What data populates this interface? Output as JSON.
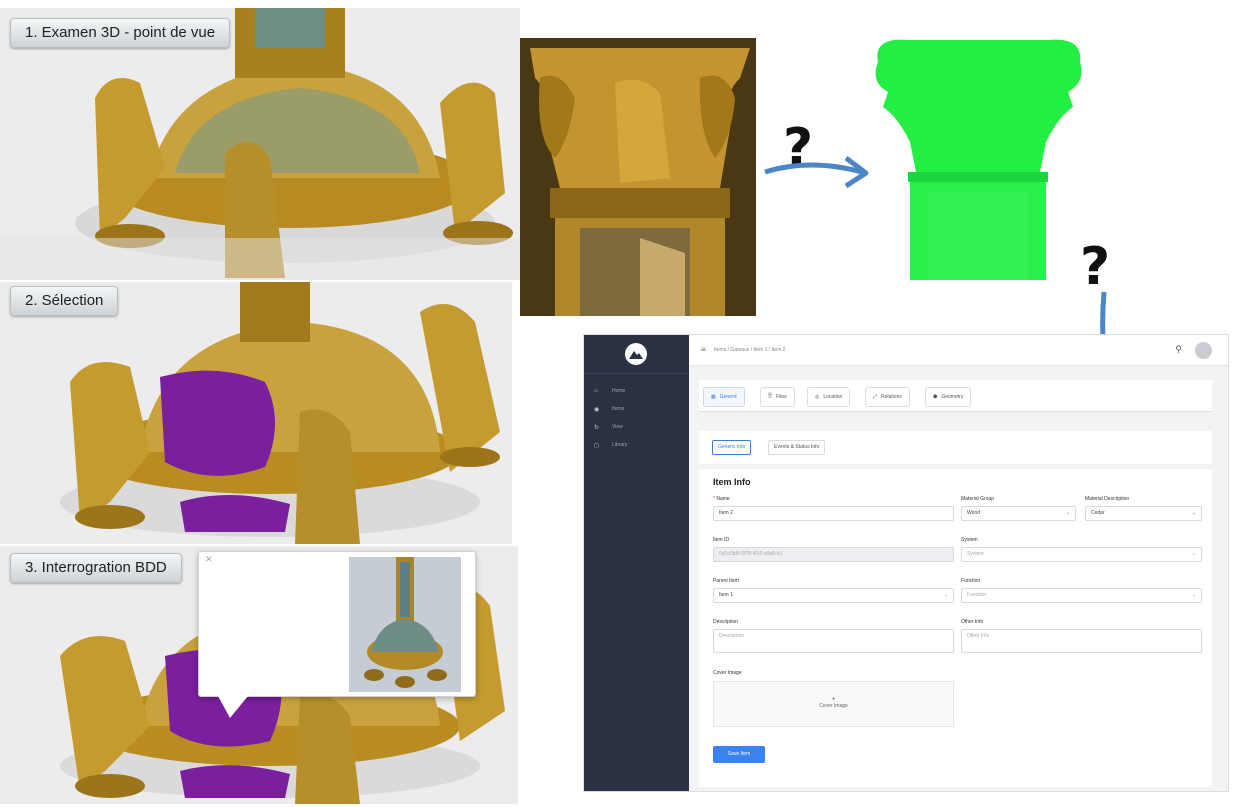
{
  "steps": [
    {
      "label": "1. Examen 3D - point de vue"
    },
    {
      "label": "2. Sélection"
    },
    {
      "label": "3. Interrogration BDD"
    }
  ],
  "annotations": {
    "question_mark_1": "?",
    "question_mark_2": "?"
  },
  "popup": {
    "close": "✕"
  },
  "colors": {
    "selection": "#7a1f9e",
    "point_cloud": "#22ee44",
    "arrow": "#4d86c6",
    "gold": "#b8902c",
    "button": "#3b82f6"
  },
  "app": {
    "sidebar": {
      "items": [
        {
          "icon": "home-icon",
          "glyph": "⌂",
          "label": "Home"
        },
        {
          "icon": "items-icon",
          "glyph": "◉",
          "label": "Items"
        },
        {
          "icon": "history-icon",
          "glyph": "↻",
          "label": "View"
        },
        {
          "icon": "library-icon",
          "glyph": "◻",
          "label": "Library"
        }
      ]
    },
    "topbar": {
      "menu_glyph": "≡",
      "breadcrumb": "Items  /  Gateaux  /  Item 1  /  Item 2",
      "search_glyph": "⚲"
    },
    "tabs": [
      {
        "icon": "generic-icon",
        "glyph": "▦",
        "label": "Generic"
      },
      {
        "icon": "files-icon",
        "glyph": "🗎",
        "label": "Files"
      },
      {
        "icon": "location-icon",
        "glyph": "◎",
        "label": "Location"
      },
      {
        "icon": "relations-icon",
        "glyph": "⤢",
        "label": "Relations"
      },
      {
        "icon": "geometry-icon",
        "glyph": "⬟",
        "label": "Geometry"
      }
    ],
    "subtabs": [
      "Generic Info",
      "Events & Status Info"
    ],
    "form": {
      "title": "Item Info",
      "name": {
        "label": "Name",
        "required": "*",
        "value": "Item 2"
      },
      "material_group": {
        "label": "Material Group",
        "value": "Wood"
      },
      "material_description": {
        "label": "Material Description",
        "value": "Cedar"
      },
      "item_id": {
        "label": "Item ID",
        "value": "6d1c0b8f-0f78-4f10-a9a8-b1"
      },
      "system": {
        "label": "System",
        "placeholder": "System"
      },
      "parent_item": {
        "label": "Parent Item",
        "value": "Item 1"
      },
      "function": {
        "label": "Function",
        "placeholder": "Function"
      },
      "description": {
        "label": "Description",
        "placeholder": "Description"
      },
      "other_info": {
        "label": "Other Info",
        "placeholder": "Other Info"
      },
      "cover_image": {
        "label": "Cover Image",
        "plus": "+",
        "drop_text": "Cover Image"
      },
      "save_label": "Save Item"
    },
    "chevron": "⌄"
  }
}
